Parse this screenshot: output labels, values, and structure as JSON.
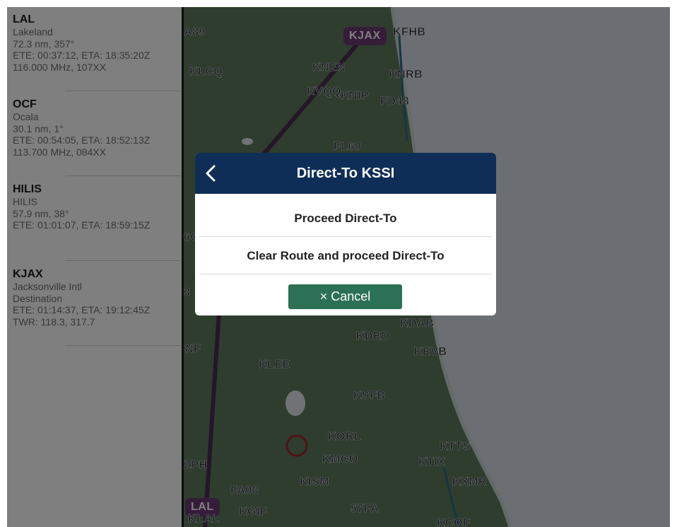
{
  "sidebar": {
    "waypoints": [
      {
        "id": "LAL",
        "lines": [
          "Lakeland",
          "72.3 nm, 357°",
          "ETE: 00:37:12, ETA: 18:35:20Z",
          "116.000 MHz, 107XX"
        ]
      },
      {
        "id": "OCF",
        "lines": [
          "Ocala",
          "30.1 nm, 1°",
          "ETE: 00:54:05, ETA: 18:52:13Z",
          "113.700 MHz, 084XX"
        ]
      },
      {
        "id": "HILIS",
        "lines": [
          "HILIS",
          "57.9 nm, 38°",
          "ETE: 01:01:07, ETA: 18:59:15Z"
        ]
      },
      {
        "id": "KJAX",
        "lines": [
          "Jacksonville Intl",
          "Destination",
          "ETE: 01:14:37, ETA: 19:12:45Z",
          "TWR: 118.3, 317.7"
        ]
      }
    ]
  },
  "map": {
    "airports": [
      "A89",
      "KJAX",
      "KFHB",
      "KLCQ",
      "KNEN",
      "KNRB",
      "KVQQ",
      "KNIP",
      "FD48",
      "FL60",
      "KDAB",
      "KDED",
      "KEVB",
      "NF",
      "KLEE",
      "KSFB",
      "KORL",
      "KTTS",
      "KMCO",
      "KTIX",
      "ZPH",
      "KXMR",
      "KISM",
      "FA08",
      "LAL",
      "KGIF",
      "57FA",
      "KCOF",
      "6C",
      "3",
      "KLAL"
    ],
    "colors": {
      "route": "#4a2a55",
      "highlight": "#6a3b73",
      "land": "#5d7a5b",
      "ocean": "#d7dee6"
    }
  },
  "dialog": {
    "title": "Direct-To KSSI",
    "back_icon": "chevron-left-icon",
    "option_proceed": "Proceed Direct-To",
    "option_clear": "Clear Route and proceed Direct-To",
    "cancel_label": "× Cancel",
    "header_color": "#0f2e57",
    "cancel_color": "#2c7055"
  }
}
